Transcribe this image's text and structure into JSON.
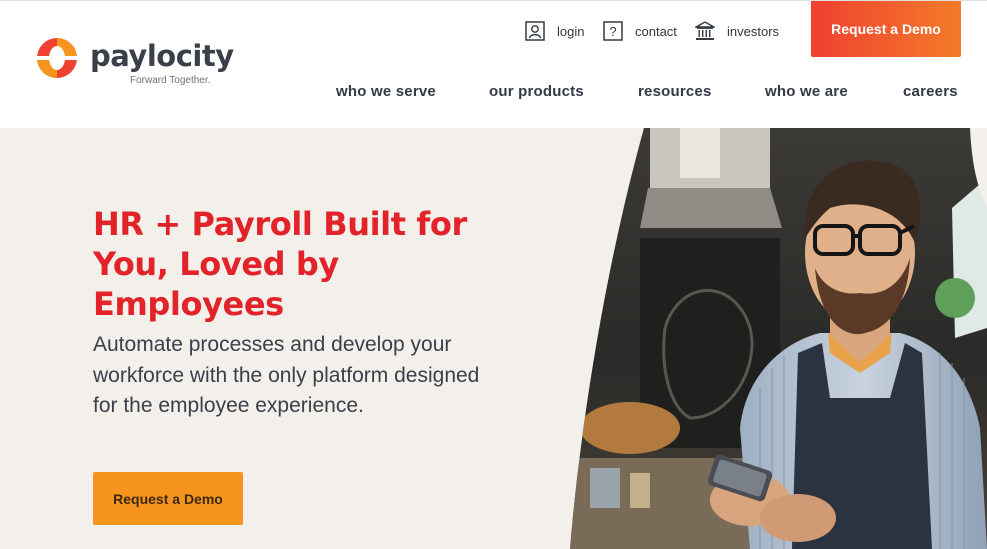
{
  "brand": {
    "name": "paylocity",
    "tagline": "Forward Together.",
    "colors": {
      "red": "#e2232a",
      "orange": "#f7941d",
      "dark": "#3a3f4a"
    }
  },
  "utility_nav": {
    "login": {
      "label": "login",
      "icon": "user-icon"
    },
    "contact": {
      "label": "contact",
      "icon": "question-icon"
    },
    "investors": {
      "label": "investors",
      "icon": "building-icon"
    }
  },
  "header_cta": {
    "label": "Request a Demo"
  },
  "main_nav": [
    {
      "label": "who we serve"
    },
    {
      "label": "our products"
    },
    {
      "label": "resources"
    },
    {
      "label": "who we are"
    },
    {
      "label": "careers"
    }
  ],
  "hero": {
    "title": "HR + Payroll Built for You, Loved by Employees",
    "subtitle": "Automate processes and develop your workforce with the only platform designed for the employee experience.",
    "cta": "Request a Demo",
    "image": "man-with-phone-in-apron-photo"
  }
}
